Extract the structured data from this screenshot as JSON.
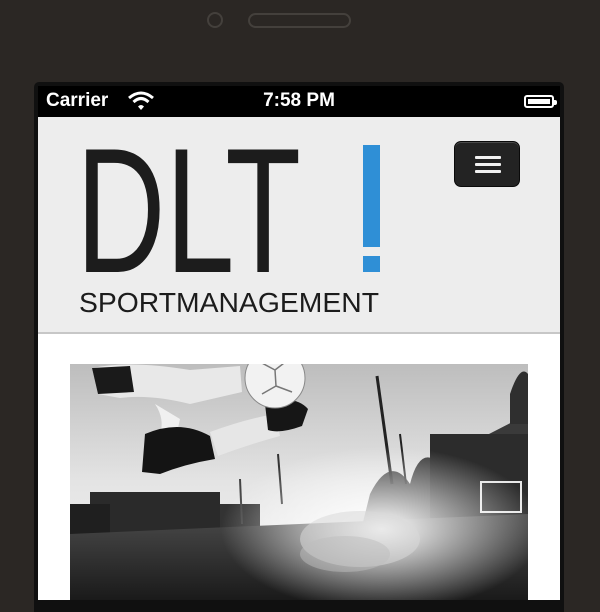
{
  "device": {
    "status_bar": {
      "carrier": "Carrier",
      "time": "7:58 PM",
      "wifi_icon": "wifi-icon",
      "battery_icon": "battery-icon"
    }
  },
  "header": {
    "logo_letters": "DLT",
    "logo_mark": "!",
    "logo_subtitle": "SPORTMANAGEMENT",
    "menu_icon": "hamburger-menu-icon"
  },
  "hero_image": {
    "description_icon": "soccer-player-photo"
  },
  "colors": {
    "device_frame": "#2b2724",
    "header_background": "#ededed",
    "logo_text": "#1c1c1c",
    "accent_blue": "#2f8fd6",
    "menu_button": "#232323"
  }
}
